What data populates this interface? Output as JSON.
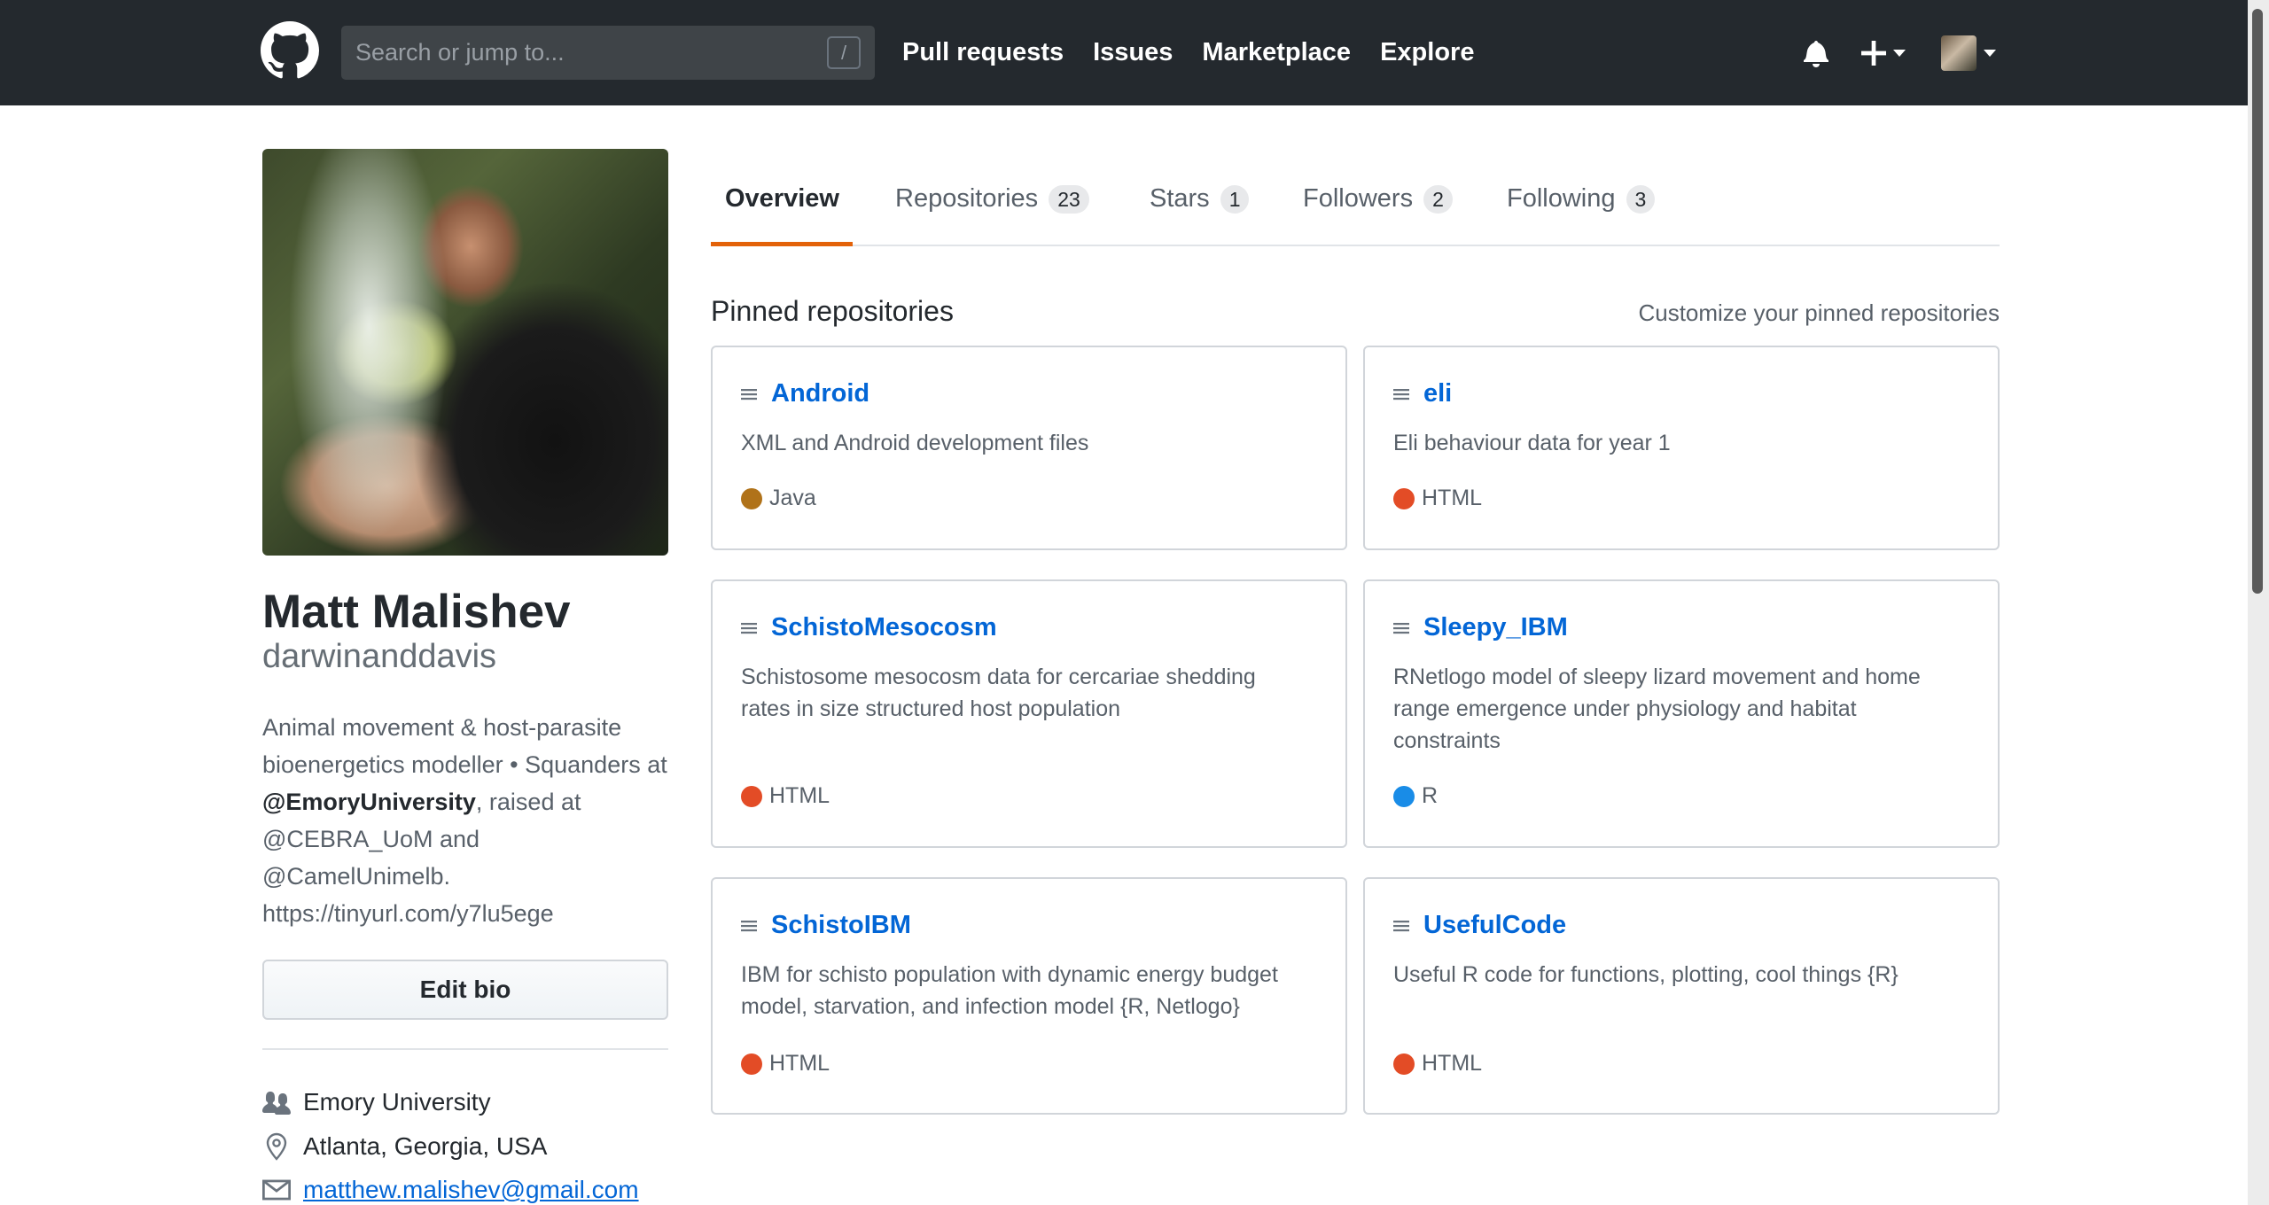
{
  "header": {
    "search_placeholder": "Search or jump to...",
    "slash_key": "/",
    "nav": [
      "Pull requests",
      "Issues",
      "Marketplace",
      "Explore"
    ],
    "icons": [
      "github-logo",
      "bell-icon",
      "plus-icon",
      "avatar"
    ]
  },
  "profile": {
    "name": "Matt Malishev",
    "login": "darwinanddavis",
    "bio_before": "Animal movement & host-parasite bioenergetics modeller • Squanders at ",
    "bio_strong": "@EmoryUniversity",
    "bio_after": ", raised at @CEBRA_UoM and @CamelUnimelb. https://tinyurl.com/y7lu5ege",
    "edit_bio": "Edit bio",
    "organization": "Emory University",
    "location": "Atlanta, Georgia, USA",
    "email": "matthew.malishev@gmail.com"
  },
  "tabs": [
    {
      "label": "Overview",
      "count": null,
      "selected": true
    },
    {
      "label": "Repositories",
      "count": "23"
    },
    {
      "label": "Stars",
      "count": "1"
    },
    {
      "label": "Followers",
      "count": "2"
    },
    {
      "label": "Following",
      "count": "3"
    }
  ],
  "pinned": {
    "title": "Pinned repositories",
    "customize": "Customize your pinned repositories",
    "repos": [
      {
        "name": "Android",
        "desc": "XML and Android development files",
        "lang": "Java",
        "color": "#b07219"
      },
      {
        "name": "eli",
        "desc": "Eli behaviour data for year 1",
        "lang": "HTML",
        "color": "#e34c26"
      },
      {
        "name": "SchistoMesocosm",
        "desc": "Schistosome mesocosm data for cercariae shedding rates in size structured host population",
        "lang": "HTML",
        "color": "#e34c26"
      },
      {
        "name": "Sleepy_IBM",
        "desc": "RNetlogo model of sleepy lizard movement and home range emergence under physiology and habitat constraints",
        "lang": "R",
        "color": "#198ce7"
      },
      {
        "name": "SchistoIBM",
        "desc": "IBM for schisto population with dynamic energy budget model, starvation, and infection model {R, Netlogo}",
        "lang": "HTML",
        "color": "#e34c26"
      },
      {
        "name": "UsefulCode",
        "desc": "Useful R code for functions, plotting, cool things {R}",
        "lang": "HTML",
        "color": "#e34c26"
      }
    ]
  }
}
